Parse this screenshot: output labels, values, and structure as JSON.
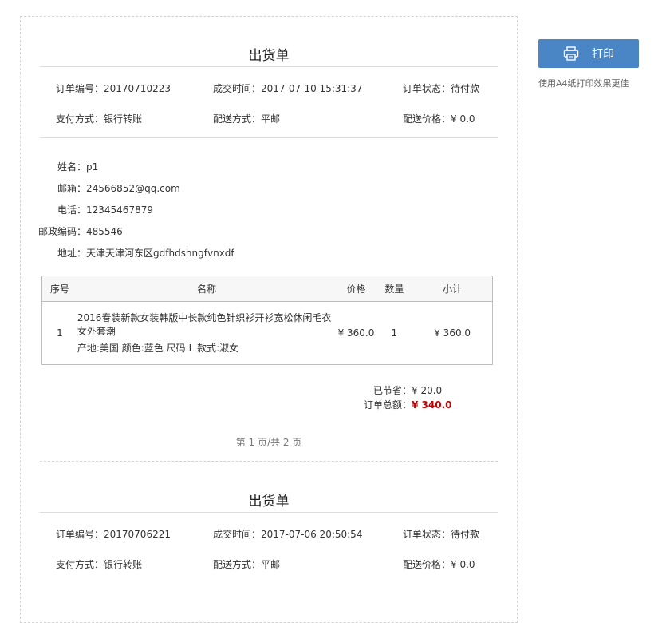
{
  "print": {
    "button_label": "打印",
    "hint": "使用A4纸打印效果更佳"
  },
  "orders": [
    {
      "title": "出货单",
      "order_no": "订单编号：20170710223",
      "deal_time": "成交时间：2017-07-10 15:31:37",
      "status": "订单状态：待付款",
      "payment": "支付方式：银行转账",
      "shipping": "配送方式：平邮",
      "shipping_price": "配送价格：¥ 0.0",
      "customer": [
        {
          "label": "姓名：",
          "value": "p1"
        },
        {
          "label": "邮箱：",
          "value": "24566852@qq.com"
        },
        {
          "label": "电话：",
          "value": "12345467879"
        },
        {
          "label": "邮政编码：",
          "value": "485546"
        },
        {
          "label": "地址：",
          "value": "天津天津河东区gdfhdshngfvnxdf"
        }
      ],
      "table": {
        "headers": {
          "index": "序号",
          "name": "名称",
          "price": "价格",
          "qty": "数量",
          "subtotal": "小计"
        },
        "rows": [
          {
            "index": "1",
            "name_line1": "2016春装新款女装韩版中长款纯色针织衫开衫宽松休闲毛衣",
            "name_line2": "女外套潮",
            "spec": "产地:美国 颜色:蓝色 尺码:L 款式:淑女",
            "price": "¥ 360.0",
            "qty": "1",
            "subtotal": "¥ 360.0"
          }
        ]
      },
      "saved_label": "已节省：",
      "saved_value": "¥ 20.0",
      "total_label": "订单总额：",
      "total_value": "¥ 340.0",
      "pager": "第 1 页/共 2 页"
    },
    {
      "title": "出货单",
      "order_no": "订单编号：20170706221",
      "deal_time": "成交时间：2017-07-06 20:50:54",
      "status": "订单状态：待付款",
      "payment": "支付方式：银行转账",
      "shipping": "配送方式：平邮",
      "shipping_price": "配送价格：¥ 0.0"
    }
  ]
}
